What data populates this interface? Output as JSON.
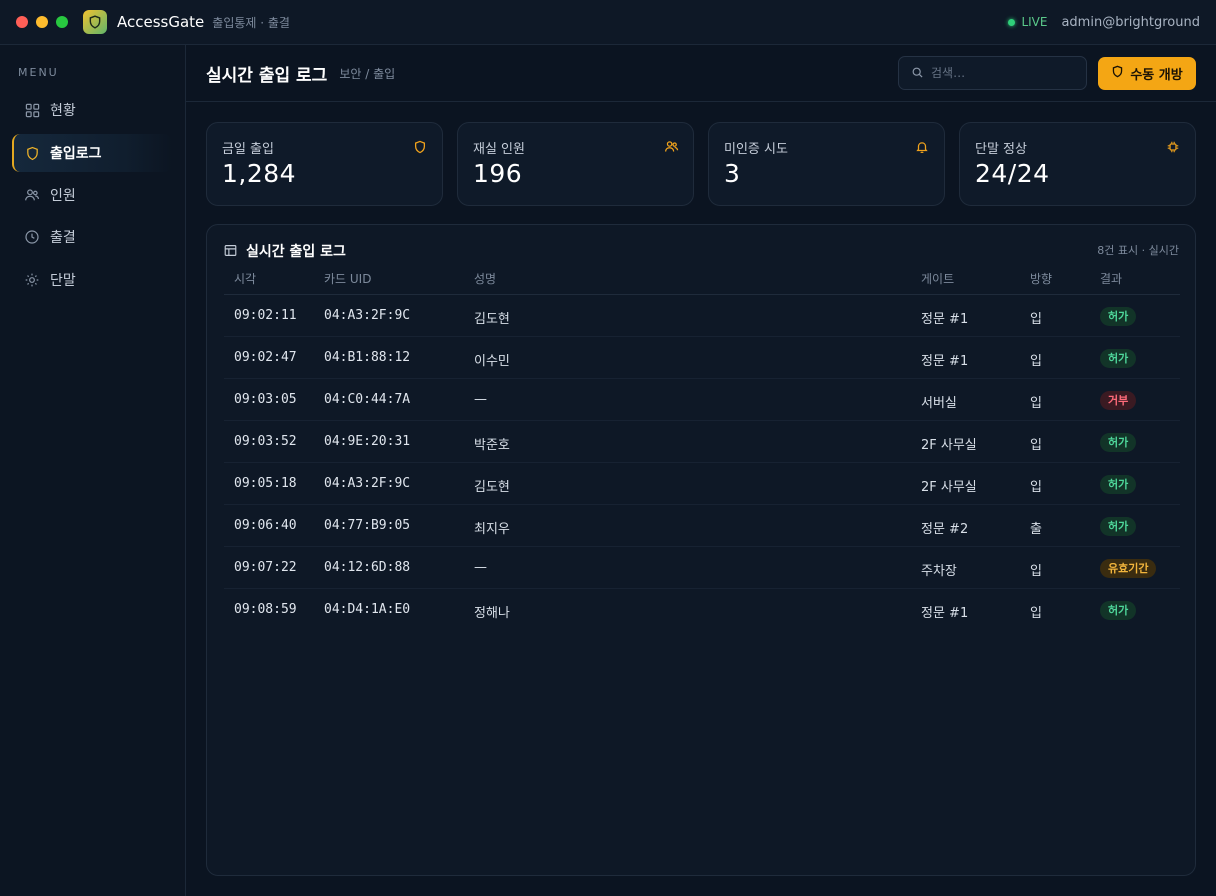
{
  "app": {
    "name": "AccessGate",
    "subtitle": "출입통제 · 출결",
    "live_label": "LIVE",
    "user": "admin@brightground"
  },
  "sidebar": {
    "menu_label": "MENU",
    "items": [
      {
        "label": "현황",
        "icon": "grid-icon"
      },
      {
        "label": "출입로그",
        "icon": "shield-icon",
        "active": true
      },
      {
        "label": "인원",
        "icon": "users-icon"
      },
      {
        "label": "출결",
        "icon": "clock-icon"
      },
      {
        "label": "단말",
        "icon": "gear-icon"
      }
    ]
  },
  "header": {
    "title": "실시간 출입 로그",
    "breadcrumb": "보안 / 출입",
    "search_placeholder": "검색…",
    "manual_open_label": "수동 개방"
  },
  "stats": [
    {
      "label": "금일 출입",
      "value": "1,284",
      "icon": "shield-icon"
    },
    {
      "label": "재실 인원",
      "value": "196",
      "icon": "users-icon"
    },
    {
      "label": "미인증 시도",
      "value": "3",
      "icon": "bell-icon"
    },
    {
      "label": "단말 정상",
      "value": "24/24",
      "icon": "chip-icon"
    }
  ],
  "log": {
    "title": "실시간 출입 로그",
    "meta": "8건 표시 · 실시간",
    "columns": [
      "시각",
      "카드 UID",
      "성명",
      "게이트",
      "방향",
      "결과"
    ],
    "rows": [
      {
        "time": "09:02:11",
        "uid": "04:A3:2F:9C",
        "name": "김도현",
        "gate": "정문 #1",
        "dir": "입",
        "result": "허가",
        "status": "ok"
      },
      {
        "time": "09:02:47",
        "uid": "04:B1:88:12",
        "name": "이수민",
        "gate": "정문 #1",
        "dir": "입",
        "result": "허가",
        "status": "ok"
      },
      {
        "time": "09:03:05",
        "uid": "04:C0:44:7A",
        "name": "—",
        "gate": "서버실",
        "dir": "입",
        "result": "거부",
        "status": "deny"
      },
      {
        "time": "09:03:52",
        "uid": "04:9E:20:31",
        "name": "박준호",
        "gate": "2F 사무실",
        "dir": "입",
        "result": "허가",
        "status": "ok"
      },
      {
        "time": "09:05:18",
        "uid": "04:A3:2F:9C",
        "name": "김도현",
        "gate": "2F 사무실",
        "dir": "입",
        "result": "허가",
        "status": "ok"
      },
      {
        "time": "09:06:40",
        "uid": "04:77:B9:05",
        "name": "최지우",
        "gate": "정문 #2",
        "dir": "출",
        "result": "허가",
        "status": "ok"
      },
      {
        "time": "09:07:22",
        "uid": "04:12:6D:88",
        "name": "—",
        "gate": "주차장",
        "dir": "입",
        "result": "유효기간",
        "status": "warn"
      },
      {
        "time": "09:08:59",
        "uid": "04:D4:1A:E0",
        "name": "정해나",
        "gate": "정문 #1",
        "dir": "입",
        "result": "허가",
        "status": "ok"
      }
    ]
  },
  "colors": {
    "accent": "#f4a614",
    "ok": "#4ed69a",
    "deny": "#ff6b7a",
    "warn": "#f2b53c",
    "background": "#0b1421"
  }
}
